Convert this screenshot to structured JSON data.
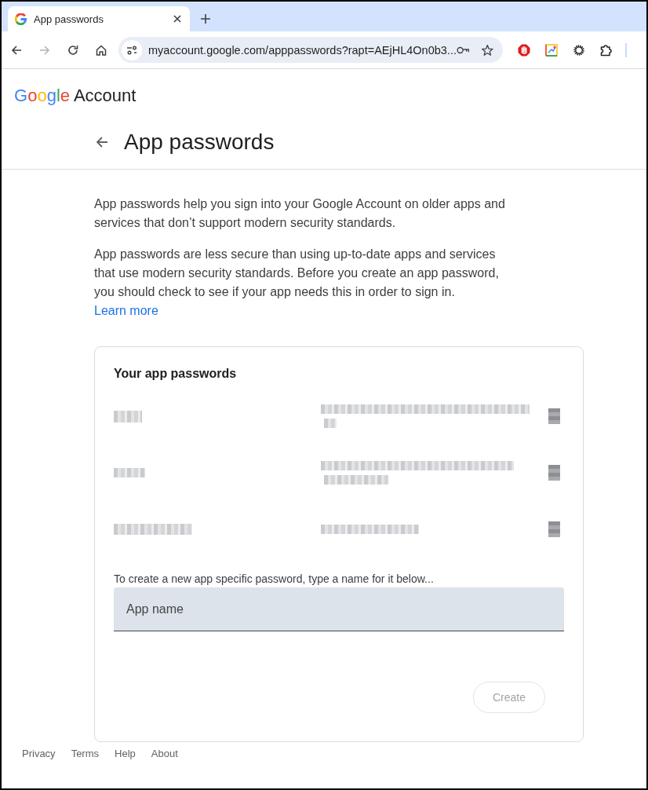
{
  "browser": {
    "tabs": [
      {
        "title": "App passwords",
        "selected": true
      }
    ],
    "url": "myaccount.google.com/apppasswords?rapt=AEjHL4On0b3..."
  },
  "header": {
    "logo": "Google",
    "product": "Account"
  },
  "page": {
    "title": "App passwords",
    "paragraphs": [
      "App passwords help you sign into your Google Account on older apps and services that don’t support modern security standards.",
      "App passwords are less secure than using up-to-date apps and services that use modern security standards. Before you create an app password, you should check to see if your app needs this in order to sign in."
    ],
    "learn_more": "Learn more"
  },
  "card": {
    "title": "Your app passwords",
    "rows": [
      {
        "kind": "redacted"
      },
      {
        "kind": "redacted"
      },
      {
        "kind": "redacted"
      }
    ],
    "instruction": "To create a new app specific password, type a name for it below...",
    "app_name": {
      "placeholder": "App name"
    },
    "create_button": {
      "label": "Create",
      "disabled": true
    }
  },
  "footer": [
    "Privacy",
    "Terms",
    "Help",
    "About"
  ]
}
